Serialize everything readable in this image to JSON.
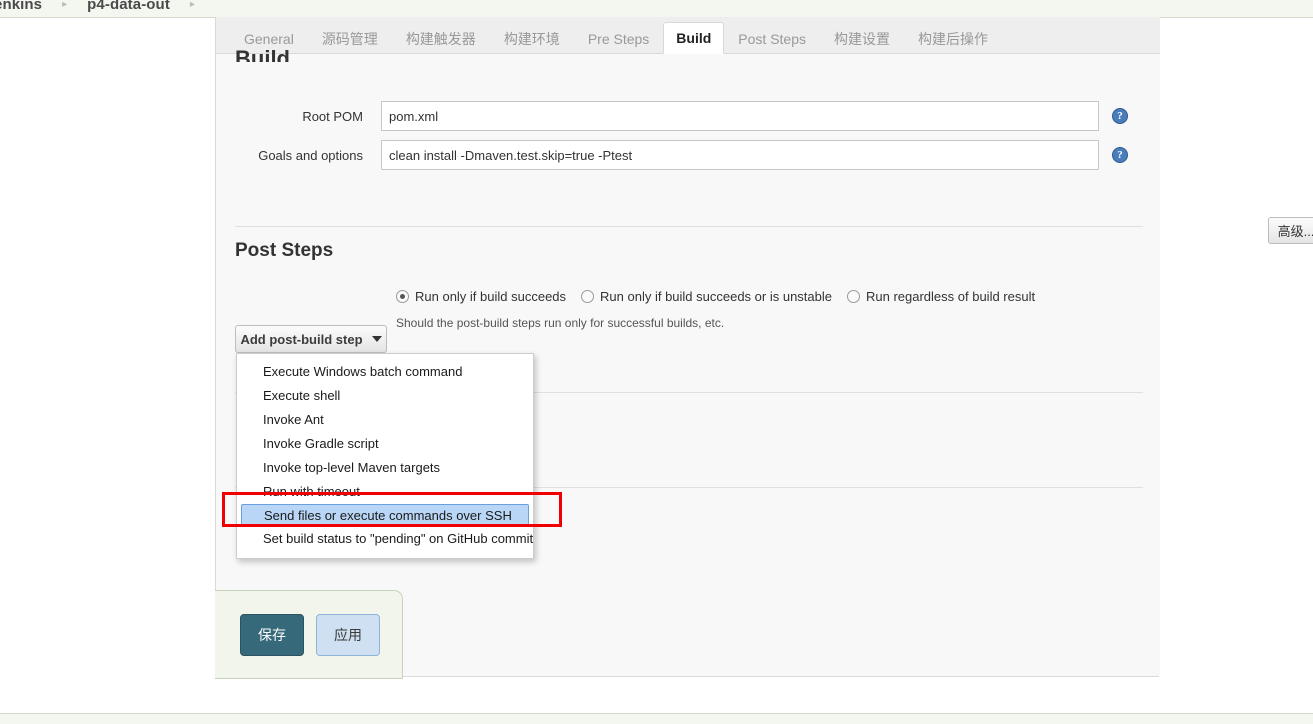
{
  "breadcrumb": {
    "items": [
      {
        "label": "enkins"
      },
      {
        "label": "p4-data-out"
      }
    ],
    "separator": "▸"
  },
  "tabs": [
    {
      "label": "General",
      "active": false
    },
    {
      "label": "源码管理",
      "active": false
    },
    {
      "label": "构建触发器",
      "active": false
    },
    {
      "label": "构建环境",
      "active": false
    },
    {
      "label": "Pre Steps",
      "active": false
    },
    {
      "label": "Build",
      "active": true
    },
    {
      "label": "Post Steps",
      "active": false
    },
    {
      "label": "构建设置",
      "active": false
    },
    {
      "label": "构建后操作",
      "active": false
    }
  ],
  "build_section": {
    "heading": "Build",
    "fields": [
      {
        "label": "Root POM",
        "value": "pom.xml",
        "help_icon": "?"
      },
      {
        "label": "Goals and options",
        "value": "clean install -Dmaven.test.skip=true -Ptest",
        "help_icon": "?"
      }
    ],
    "advanced_label": "高级..."
  },
  "post_steps": {
    "title": "Post Steps",
    "radios": [
      {
        "label": "Run only if build succeeds",
        "checked": true
      },
      {
        "label": "Run only if build succeeds or is unstable",
        "checked": false
      },
      {
        "label": "Run regardless of build result",
        "checked": false
      }
    ],
    "hint": "Should the post-build steps run only for successful builds, etc.",
    "add_step_button": "Add post-build step",
    "menu_items": [
      {
        "label": "Execute Windows batch command",
        "selected": false
      },
      {
        "label": "Execute shell",
        "selected": false
      },
      {
        "label": "Invoke Ant",
        "selected": false
      },
      {
        "label": "Invoke Gradle script",
        "selected": false
      },
      {
        "label": "Invoke top-level Maven targets",
        "selected": false
      },
      {
        "label": "Run with timeout",
        "selected": false
      },
      {
        "label": "Send files or execute commands over SSH",
        "selected": true
      },
      {
        "label": "Set build status to \"pending\" on GitHub commit",
        "selected": false
      }
    ]
  },
  "save_bar": {
    "save_label": "保存",
    "apply_label": "应用"
  },
  "colors": {
    "annotation": "#f00000",
    "save_button": "#36697a",
    "apply_button": "#cfe0f2",
    "menu_selected": "#b9d6f7",
    "help_icon": "#4a7ebb"
  }
}
